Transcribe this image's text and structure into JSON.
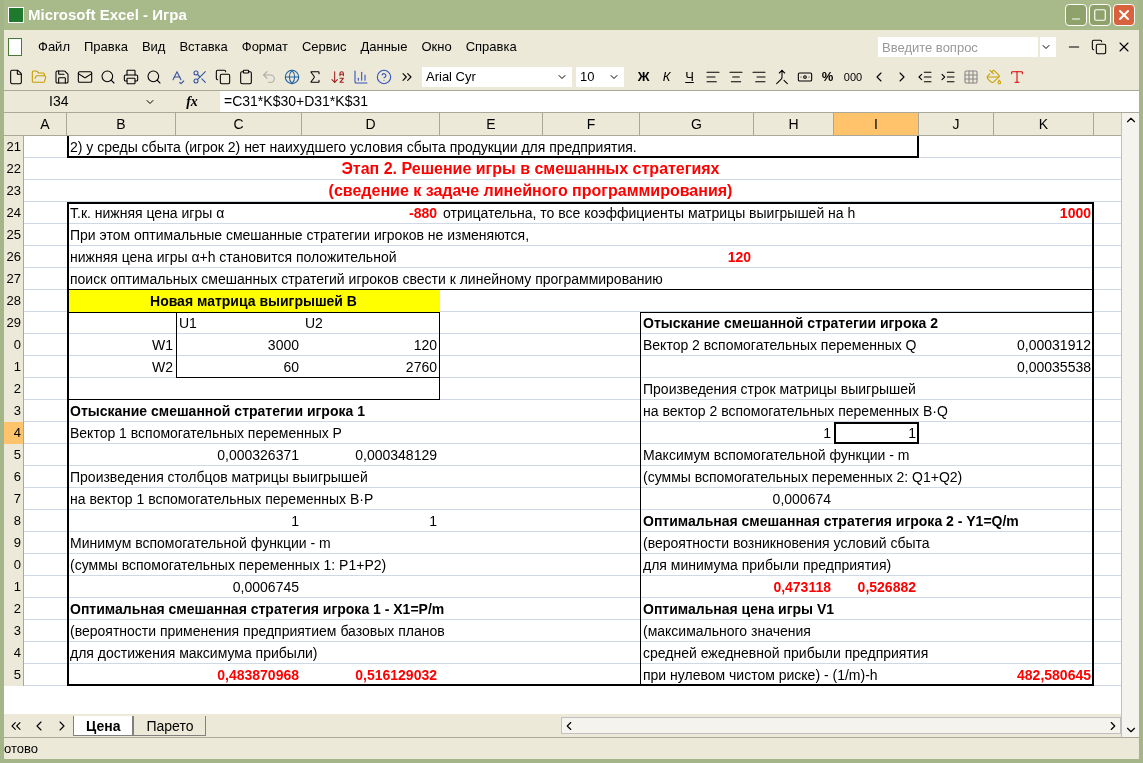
{
  "window": {
    "title": "Microsoft Excel - Игра"
  },
  "menu": [
    "Файл",
    "Правка",
    "Вид",
    "Вставка",
    "Формат",
    "Сервис",
    "Данные",
    "Окно",
    "Справка"
  ],
  "help": {
    "placeholder": "Введите вопрос"
  },
  "toolbar": {
    "font": "Arial Cyr",
    "size": "10",
    "bold": "Ж",
    "italic": "К",
    "underline": "Ч",
    "percent": "%",
    "thousands": "000"
  },
  "formula_bar": {
    "cell": "I34",
    "fx": "fx",
    "formula": "=C31*K$30+D31*K$31"
  },
  "columns": [
    {
      "label": "A",
      "selected": false
    },
    {
      "label": "B",
      "selected": false
    },
    {
      "label": "C",
      "selected": false
    },
    {
      "label": "D",
      "selected": false
    },
    {
      "label": "E",
      "selected": false
    },
    {
      "label": "F",
      "selected": false
    },
    {
      "label": "G",
      "selected": false
    },
    {
      "label": "H",
      "selected": false
    },
    {
      "label": "I",
      "selected": true
    },
    {
      "label": "J",
      "selected": false
    },
    {
      "label": "K",
      "selected": false
    }
  ],
  "rows": [
    {
      "num": "21",
      "selected": false,
      "cells": {
        "b": {
          "kind": "text",
          "text": "2) у среды сбыта (игрок 2) нет наихудшего условия сбыта продукции для предприятия."
        }
      }
    },
    {
      "num": "22",
      "selected": false,
      "cells": {
        "b": {
          "kind": "heading",
          "text": "Этап 2. Решение игры в смешанных стратегиях",
          "color": "#ff0000"
        }
      }
    },
    {
      "num": "23",
      "selected": false,
      "cells": {
        "b": {
          "kind": "heading",
          "text": "(сведение к задаче линейного программирования)",
          "color": "#ff0000"
        }
      }
    },
    {
      "num": "24",
      "selected": false,
      "cells": {
        "b": {
          "kind": "text",
          "text": "Т.к. нижняя цена игры α"
        },
        "d": {
          "kind": "number",
          "text": "-880",
          "color": "#ff0000"
        },
        "e": {
          "kind": "text",
          "text": "отрицательна, то все коэффициенты матрицы выигрышей на h"
        },
        "k": {
          "kind": "number",
          "text": "1000",
          "color": "#ff0000"
        }
      }
    },
    {
      "num": "25",
      "selected": false,
      "cells": {
        "b": {
          "kind": "text",
          "text": "При этом оптимальные смешанные стратегии игроков не изменяются,"
        }
      }
    },
    {
      "num": "26",
      "selected": false,
      "cells": {
        "b": {
          "kind": "text",
          "text": "нижняя цена игры α+h становится положительной"
        },
        "g": {
          "kind": "number",
          "text": "120",
          "color": "#ff0000"
        }
      }
    },
    {
      "num": "27",
      "selected": false,
      "cells": {
        "b": {
          "kind": "text",
          "text": "поиск оптимальных смешанных стратегий игроков  свести к линейному программированию"
        }
      }
    },
    {
      "num": "28",
      "selected": false,
      "cells": {
        "b": {
          "kind": "title",
          "text": "Новая матрица выигрышей B",
          "highlighted": true
        }
      }
    },
    {
      "num": "29",
      "selected": false,
      "cells": {
        "c": {
          "kind": "text",
          "text": "U1"
        },
        "d": {
          "kind": "text",
          "text": "U2"
        },
        "g": {
          "kind": "label",
          "text": "Отыскание смешанной стратегии игрока 2"
        }
      }
    },
    {
      "num": "0",
      "selected": false,
      "cells": {
        "b": {
          "kind": "number",
          "text": "W1"
        },
        "c": {
          "kind": "number",
          "text": "3000"
        },
        "d": {
          "kind": "number",
          "text": "120"
        },
        "g": {
          "kind": "text",
          "text": "Вектор 2 вспомогательных переменных Q"
        },
        "k": {
          "kind": "number",
          "text": "0,00031912"
        }
      }
    },
    {
      "num": "1",
      "selected": false,
      "cells": {
        "b": {
          "kind": "number",
          "text": "W2"
        },
        "c": {
          "kind": "number",
          "text": "60"
        },
        "d": {
          "kind": "number",
          "text": "2760"
        },
        "k": {
          "kind": "number",
          "text": "0,00035538"
        }
      }
    },
    {
      "num": "2",
      "selected": false,
      "cells": {
        "g": {
          "kind": "text",
          "text": "Произведения строк матрицы выигрышей"
        }
      }
    },
    {
      "num": "3",
      "selected": false,
      "cells": {
        "b": {
          "kind": "label",
          "text": "Отыскание смешанной стратегии игрока 1"
        },
        "g": {
          "kind": "text",
          "text": "на  вектор 2 вспомогательных переменных B·Q"
        }
      }
    },
    {
      "num": "4",
      "selected": true,
      "cells": {
        "b": {
          "kind": "text",
          "text": "Вектор 1 вспомогательных переменных P"
        },
        "h": {
          "kind": "number",
          "text": "1"
        },
        "i": {
          "kind": "number",
          "text": "1",
          "active": true
        }
      }
    },
    {
      "num": "5",
      "selected": false,
      "cells": {
        "c": {
          "kind": "number",
          "text": "0,000326371"
        },
        "d": {
          "kind": "number",
          "text": "0,000348129"
        },
        "g": {
          "kind": "text",
          "text": "Максимум вспомогательной функции - m"
        }
      }
    },
    {
      "num": "6",
      "selected": false,
      "cells": {
        "b": {
          "kind": "text",
          "text": "Произведения столбцов матрицы выигрышей"
        },
        "g": {
          "kind": "text",
          "text": "(суммы вспомогательных переменных 2: Q1+Q2)"
        }
      }
    },
    {
      "num": "7",
      "selected": false,
      "cells": {
        "b": {
          "kind": "text",
          "text": "на  вектор 1 вспомогательных переменных B·P"
        },
        "h": {
          "kind": "number",
          "text": "0,000674"
        }
      }
    },
    {
      "num": "8",
      "selected": false,
      "cells": {
        "c": {
          "kind": "number",
          "text": "1"
        },
        "d": {
          "kind": "number",
          "text": "1"
        },
        "g": {
          "kind": "label",
          "text": "Оптимальная смешанная стратегия игрока 2 - Y1=Q/m"
        }
      }
    },
    {
      "num": "9",
      "selected": false,
      "cells": {
        "b": {
          "kind": "text",
          "text": "Минимум вспомогательной функции - m"
        },
        "g": {
          "kind": "text",
          "text": "(вероятности возникновения условий сбыта"
        }
      }
    },
    {
      "num": "0",
      "selected": false,
      "cells": {
        "b": {
          "kind": "text",
          "text": "(суммы вспомогательных переменных 1: P1+P2)"
        },
        "g": {
          "kind": "text",
          "text": "для минимума прибыли предприятия)"
        }
      }
    },
    {
      "num": "1",
      "selected": false,
      "cells": {
        "c": {
          "kind": "number",
          "text": "0,0006745"
        },
        "h": {
          "kind": "number",
          "text": "0,473118",
          "color": "#ff0000"
        },
        "i": {
          "kind": "number",
          "text": "0,526882",
          "color": "#ff0000"
        }
      }
    },
    {
      "num": "2",
      "selected": false,
      "cells": {
        "b": {
          "kind": "label",
          "text": "Оптимальная смешанная стратегия игрока 1 - X1=P/m"
        },
        "g": {
          "kind": "label",
          "text": "Оптимальная цена игры V1"
        }
      }
    },
    {
      "num": "3",
      "selected": false,
      "cells": {
        "b": {
          "kind": "text",
          "text": "(вероятности применения предприятием базовых планов"
        },
        "g": {
          "kind": "text",
          "text": "(максимального значения"
        }
      }
    },
    {
      "num": "4",
      "selected": false,
      "cells": {
        "b": {
          "kind": "text",
          "text": "для достижения максимума прибыли)"
        },
        "g": {
          "kind": "text",
          "text": "средней ежедневной прибыли предприятия"
        }
      }
    },
    {
      "num": "5",
      "selected": false,
      "cells": {
        "c": {
          "kind": "number",
          "text": "0,483870968",
          "color": "#ff0000"
        },
        "d": {
          "kind": "number",
          "text": "0,516129032",
          "color": "#ff0000"
        },
        "g": {
          "kind": "text",
          "text": "при нулевом чистом риске) - (1/m)-h"
        },
        "k": {
          "kind": "number",
          "text": "482,580645",
          "color": "#ff0000"
        }
      }
    }
  ],
  "sheets": [
    {
      "label": "Цена",
      "selected": true
    },
    {
      "label": "Парето",
      "selected": false
    }
  ],
  "status": "отово"
}
